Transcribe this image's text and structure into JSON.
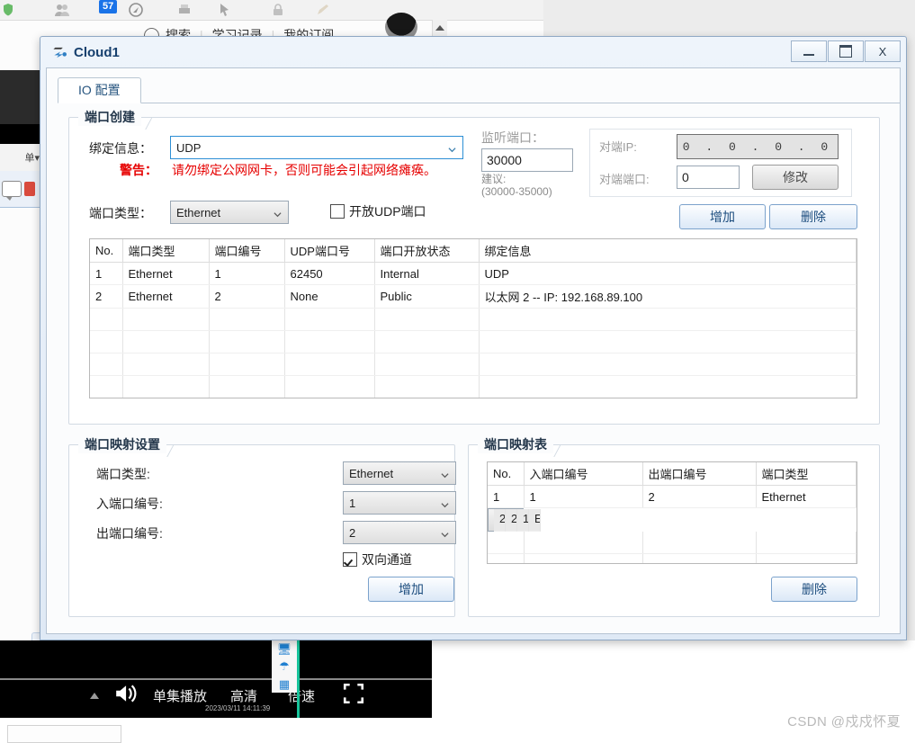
{
  "window": {
    "title": "Cloud1",
    "icon": "cloud-network-icon",
    "controls": {
      "minimize": "–",
      "maximize": "▭",
      "close": "X"
    }
  },
  "tabs": [
    {
      "label": "IO 配置",
      "selected": true
    }
  ],
  "port_create": {
    "group_label": "端口创建",
    "binding_label": "绑定信息：",
    "binding_value": "UDP",
    "warning_prefix": "警告：",
    "warning_text": "请勿绑定公网网卡，否则可能会引起网络瘫痪。",
    "warning_color": "#e60000",
    "port_type_label": "端口类型：",
    "port_type_value": "Ethernet",
    "open_udp_label": "开放UDP端口",
    "open_udp_checked": false,
    "listen_port_label": "监听端口：",
    "listen_port_value": "30000",
    "listen_hint_1": "建议:",
    "listen_hint_2": "(30000-35000)",
    "peer_ip_label": "对端IP:",
    "peer_ip_value": "0 . 0 . 0 . 0",
    "peer_port_label": "对端端口:",
    "peer_port_value": "0",
    "modify_label": "修改",
    "add_label": "增加",
    "delete_label": "删除"
  },
  "port_table": {
    "columns": [
      "No.",
      "端口类型",
      "端口编号",
      "UDP端口号",
      "端口开放状态",
      "绑定信息"
    ],
    "rows": [
      [
        "1",
        "Ethernet",
        "1",
        "62450",
        "Internal",
        "UDP"
      ],
      [
        "2",
        "Ethernet",
        "2",
        "None",
        "Public",
        "以太网 2 -- IP: 192.168.89.100"
      ]
    ],
    "empty_rows": 5
  },
  "mapping_settings": {
    "group_label": "端口映射设置",
    "port_type_label": "端口类型:",
    "port_type_value": "Ethernet",
    "in_port_label": "入端口编号:",
    "in_port_value": "1",
    "out_port_label": "出端口编号:",
    "out_port_value": "2",
    "bidirectional_label": "双向通道",
    "bidirectional_checked": true,
    "add_label": "增加"
  },
  "mapping_table": {
    "group_label": "端口映射表",
    "columns": [
      "No.",
      "入端口编号",
      "出端口编号",
      "端口类型"
    ],
    "rows": [
      [
        "1",
        "1",
        "2",
        "Ethernet"
      ],
      [
        "2",
        "2",
        "1",
        "Ethernet"
      ]
    ],
    "selected_row_index": 1,
    "empty_rows": 3,
    "delete_label": "删除"
  },
  "background": {
    "nav_items": [
      "搜索",
      "学习记录",
      "我的订阅"
    ],
    "notification_badge": "57",
    "video_controls": [
      "单集播放",
      "高清",
      "倍速"
    ],
    "video_timestamp": "2023/03/11 14:11:39",
    "watermark": "CSDN @戍戍怀夏"
  }
}
